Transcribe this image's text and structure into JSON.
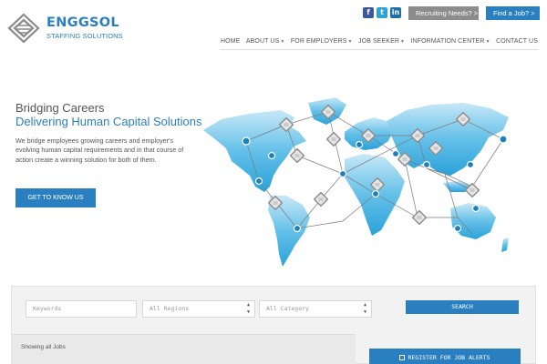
{
  "brand": {
    "name": "ENGGSOL",
    "tagline": "STAFFING SOLUTIONS",
    "accent": "#2a7fc0"
  },
  "social": [
    {
      "name": "facebook-icon",
      "glyph": "f",
      "color": "#3b5998"
    },
    {
      "name": "twitter-icon",
      "glyph": "t",
      "color": "#2ea3d6"
    },
    {
      "name": "linkedin-icon",
      "glyph": "in",
      "color": "#1f6fa8"
    }
  ],
  "header_buttons": {
    "recruiting": "Recruiting Needs? >",
    "find_job": "Find a Job? >"
  },
  "nav": {
    "home": "HOME",
    "about": "ABOUT US",
    "employers": "FOR EMPLOYERS",
    "seeker": "JOB SEEKER",
    "info": "INFORMATION CENTER",
    "contact": "CONTACT US"
  },
  "hero": {
    "title_line1": "Bridging Careers",
    "title_line2": "Delivering Human Capital Solutions",
    "body": "We bridge employees growing careers and employer's evolving human capital requirements and in that course of action create a winning solution for both of them.",
    "cta": "GET TO KNOW US"
  },
  "search": {
    "keywords_placeholder": "Keywords",
    "region_value": "All Regions",
    "category_value": "All Category",
    "button": "SEARCH"
  },
  "listing": {
    "status": "Showing all Jobs",
    "alert_button": "REGISTER FOR JOB ALERTS"
  }
}
